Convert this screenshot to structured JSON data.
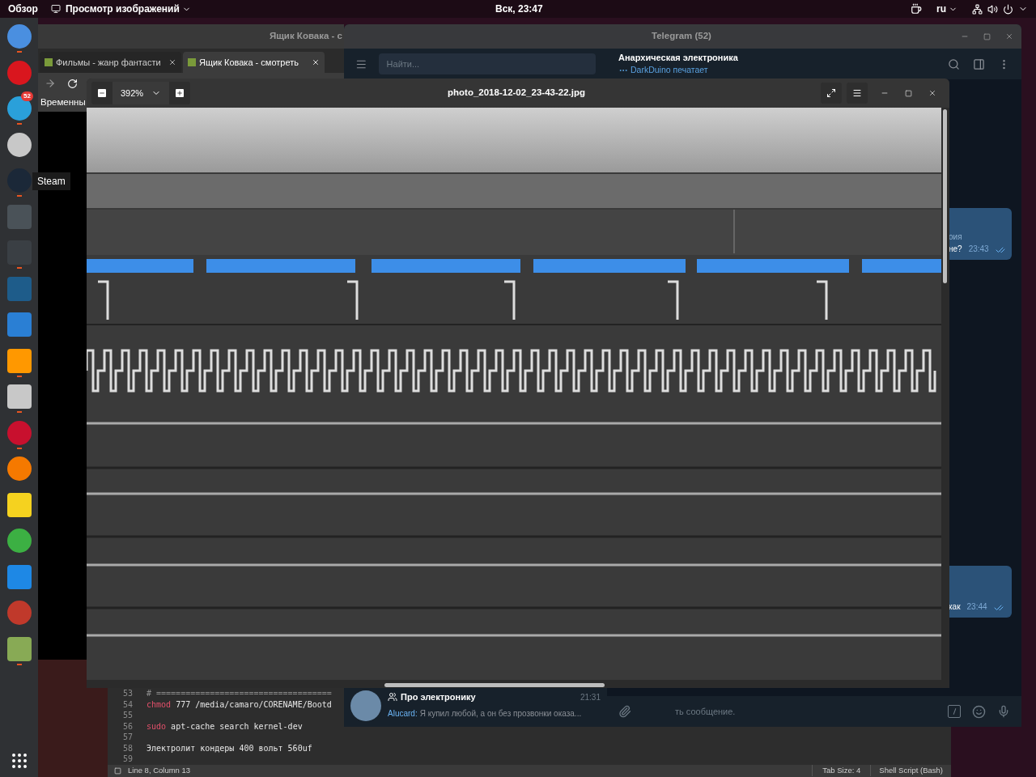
{
  "top_bar": {
    "overview": "Обзор",
    "app_menu": "Просмотр изображений",
    "clock": "Вск, 23:47",
    "language": "ru"
  },
  "dock": {
    "items": [
      {
        "kind": "circle",
        "color": "#4a8fe0",
        "running": true
      },
      {
        "kind": "circle",
        "color": "#d9161e",
        "running": false
      },
      {
        "kind": "circle",
        "color": "#2aa0da",
        "running": true,
        "badge": "52"
      },
      {
        "kind": "circle",
        "color": "#c8c8c8",
        "running": false
      },
      {
        "kind": "circle",
        "color": "#1b2838",
        "running": true
      },
      {
        "kind": "square",
        "color": "#4a5258",
        "running": false
      },
      {
        "kind": "square",
        "color": "#3a3f44",
        "running": true
      },
      {
        "kind": "square",
        "color": "#1e5c8a",
        "running": false
      },
      {
        "kind": "square",
        "color": "#2a7fd4",
        "running": false
      },
      {
        "kind": "square",
        "color": "#ff9800",
        "running": true
      },
      {
        "kind": "square",
        "color": "#c8c8c8",
        "running": true
      },
      {
        "kind": "circle",
        "color": "#c8102e",
        "running": true
      },
      {
        "kind": "circle",
        "color": "#f57900",
        "running": false
      },
      {
        "kind": "square",
        "color": "#f5d21f",
        "running": false
      },
      {
        "kind": "circle",
        "color": "#3cb043",
        "running": false
      },
      {
        "kind": "square",
        "color": "#1e88e5",
        "running": false
      },
      {
        "kind": "circle",
        "color": "#c0392b",
        "running": false
      },
      {
        "kind": "square",
        "color": "#88aa55",
        "running": true
      }
    ],
    "tooltip": "Steam"
  },
  "browser": {
    "title": "Ящик Ковака - с",
    "tabs": [
      {
        "label": "Фильмы - жанр фантасти",
        "selected": false
      },
      {
        "label": "Ящик Ковака - смотреть",
        "selected": true
      }
    ],
    "bookmark": "Временны"
  },
  "telegram": {
    "title": "Telegram (52)",
    "search_placeholder": "Найти...",
    "chat_title": "Анархическая электроника",
    "typing": "DarkDuino печатает",
    "messages": [
      {
        "lines": [
          "оия",
          "не?"
        ],
        "time": "23:43",
        "read": true
      },
      {
        "lines": [
          "как"
        ],
        "time": "23:44",
        "read": true
      }
    ],
    "chat_item": {
      "name": "Про электронику",
      "time": "21:31",
      "sender": "Alucard:",
      "preview": "Я купил любой, а он без прозвонки оказа..."
    },
    "composer_placeholder": "ть сообщение."
  },
  "viewer": {
    "zoom": "392%",
    "filename": "photo_2018-12-02_23-43-22.jpg"
  },
  "editor": {
    "lines": [
      {
        "number": "53",
        "segments": [
          {
            "kind": "comment",
            "text": "# ===================================="
          }
        ]
      },
      {
        "number": "54",
        "segments": [
          {
            "kind": "keyword",
            "text": "chmod"
          },
          {
            "kind": "plain",
            "text": " 777 /media/camaro/CORENAME/Bootd"
          }
        ]
      },
      {
        "number": "55"
      },
      {
        "number": "56",
        "segments": [
          {
            "kind": "keyword",
            "text": "sudo"
          },
          {
            "kind": "plain",
            "text": " apt-cache search kernel-dev"
          }
        ]
      },
      {
        "number": "57"
      },
      {
        "number": "58",
        "segments": [
          {
            "kind": "plain",
            "text": "Электролит кондеры 400 вольт 560uf"
          }
        ]
      },
      {
        "number": "59"
      }
    ],
    "position": "Line 8, Column 13",
    "tab_size": "Tab Size: 4",
    "language": "Shell Script (Bash)"
  }
}
